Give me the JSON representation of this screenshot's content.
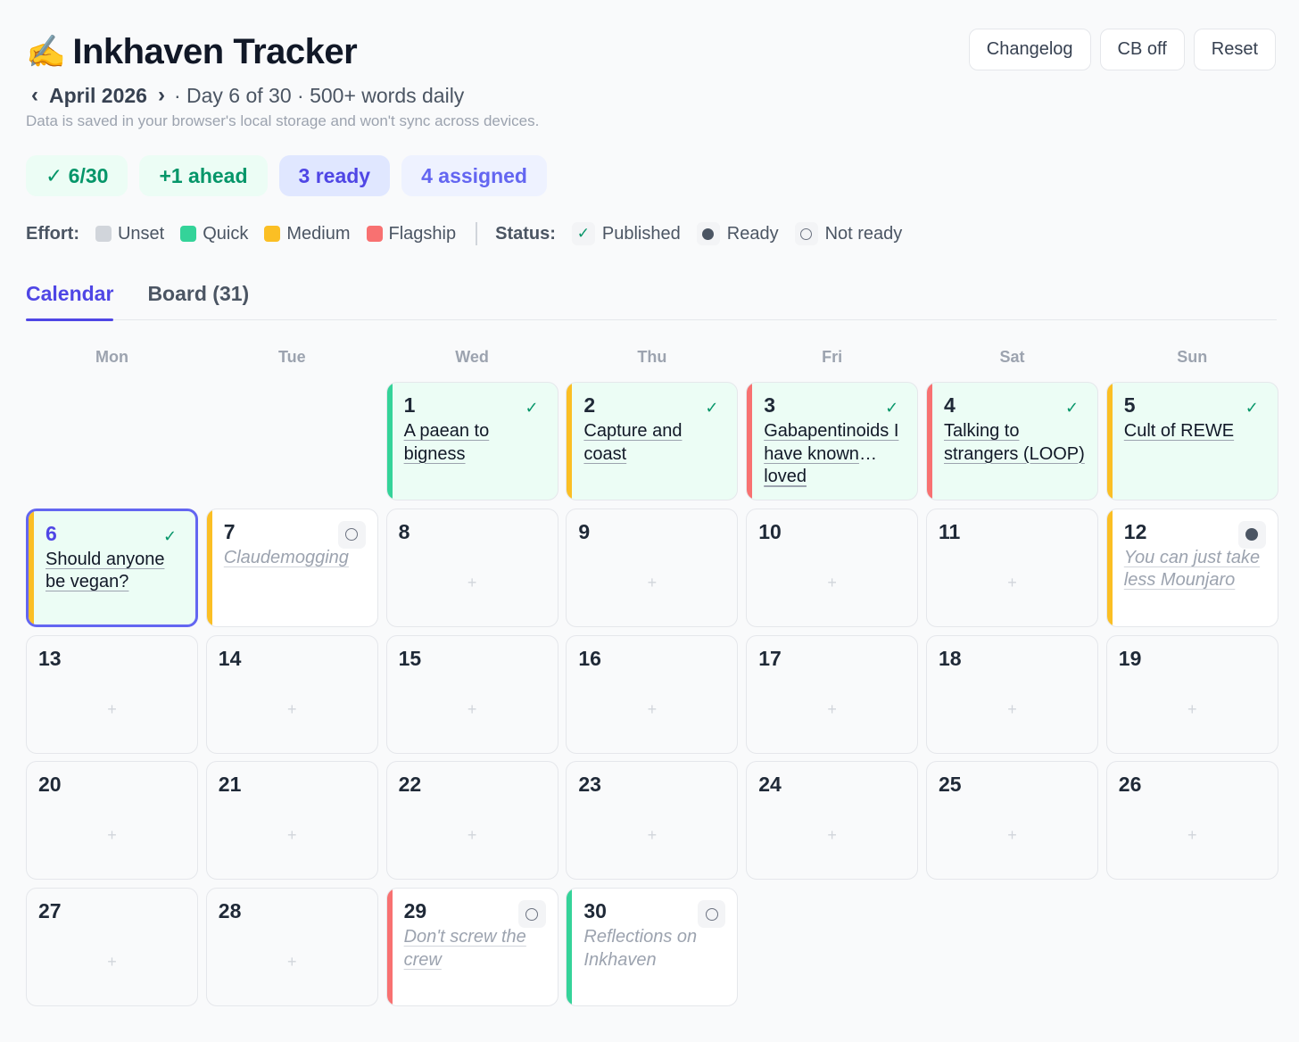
{
  "header": {
    "emoji": "✍️",
    "title": "Inkhaven Tracker",
    "prev_arrow": "‹",
    "month": "April 2026",
    "next_arrow": "›",
    "subinfo": "· Day 6 of 30 · 500+ words daily",
    "storage_note": "Data is saved in your browser's local storage and won't sync across devices."
  },
  "top_buttons": {
    "changelog": "Changelog",
    "cb": "CB off",
    "reset": "Reset"
  },
  "badges": {
    "progress": "✓ 6/30",
    "ahead": "+1 ahead",
    "ready": "3 ready",
    "assigned": "4 assigned"
  },
  "legend": {
    "effort_label": "Effort:",
    "efforts": [
      {
        "label": "Unset",
        "color": "#d1d5db"
      },
      {
        "label": "Quick",
        "color": "#34d399"
      },
      {
        "label": "Medium",
        "color": "#fbbf24"
      },
      {
        "label": "Flagship",
        "color": "#f87171"
      }
    ],
    "status_label": "Status:",
    "statuses": [
      {
        "label": "Published",
        "icon": "check-icon"
      },
      {
        "label": "Ready",
        "icon": "filled-dot-icon"
      },
      {
        "label": "Not ready",
        "icon": "empty-circle-icon"
      }
    ]
  },
  "tabs": {
    "calendar": "Calendar",
    "board": "Board (31)"
  },
  "weekdays": [
    "Mon",
    "Tue",
    "Wed",
    "Thu",
    "Fri",
    "Sat",
    "Sun"
  ],
  "calendar": {
    "add_symbol": "+",
    "check_symbol": "✓",
    "days": [
      {
        "day": "1",
        "title": "A paean to bigness",
        "effort": "quick",
        "status": "published"
      },
      {
        "day": "2",
        "title": "Capture and coast",
        "effort": "medium",
        "status": "published"
      },
      {
        "day": "3",
        "title": "Gabapentinoids I have known and…",
        "title_line3": "loved",
        "effort": "flagship",
        "status": "published"
      },
      {
        "day": "4",
        "title": "Talking to strangers (LOOP)",
        "effort": "flagship",
        "status": "published"
      },
      {
        "day": "5",
        "title": "Cult of REWE",
        "effort": "medium",
        "status": "published"
      },
      {
        "day": "6",
        "title": "Should anyone be vegan?",
        "effort": "medium",
        "status": "published",
        "today": true
      },
      {
        "day": "7",
        "title": "Claudemogging",
        "effort": "medium",
        "status": "not-ready"
      },
      {
        "day": "8"
      },
      {
        "day": "9"
      },
      {
        "day": "10"
      },
      {
        "day": "11"
      },
      {
        "day": "12",
        "title": "You can just take less Mounjaro",
        "effort": "medium",
        "status": "ready"
      },
      {
        "day": "13"
      },
      {
        "day": "14"
      },
      {
        "day": "15"
      },
      {
        "day": "16"
      },
      {
        "day": "17"
      },
      {
        "day": "18"
      },
      {
        "day": "19"
      },
      {
        "day": "20"
      },
      {
        "day": "21"
      },
      {
        "day": "22"
      },
      {
        "day": "23"
      },
      {
        "day": "24"
      },
      {
        "day": "25"
      },
      {
        "day": "26"
      },
      {
        "day": "27"
      },
      {
        "day": "28"
      },
      {
        "day": "29",
        "title": "Don't screw the crew",
        "effort": "flagship",
        "status": "not-ready"
      },
      {
        "day": "30",
        "title": "Reflections on Inkhaven",
        "effort": "quick",
        "status": "not-ready",
        "no_underline": true
      }
    ]
  }
}
